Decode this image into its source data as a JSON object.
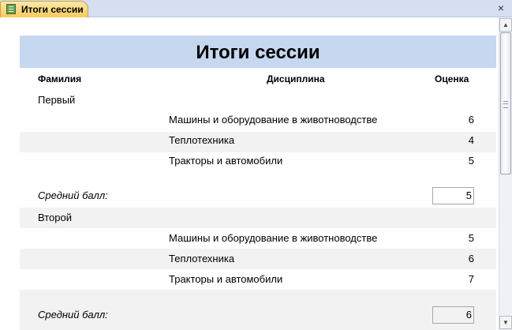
{
  "tab": {
    "title": "Итоги сессии",
    "icon": "report-icon",
    "close": "×"
  },
  "report": {
    "title": "Итоги сессии",
    "columns": {
      "surname": "Фамилия",
      "discipline": "Дисциплина",
      "grade": "Оценка"
    },
    "avg_label": "Средний балл:",
    "groups": [
      {
        "name": "Первый",
        "rows": [
          {
            "discipline": "Машины и оборудование в животноводстве",
            "grade": "6"
          },
          {
            "discipline": "Теплотехника",
            "grade": "4"
          },
          {
            "discipline": "Тракторы и автомобили",
            "grade": "5"
          }
        ],
        "average": "5"
      },
      {
        "name": "Второй",
        "rows": [
          {
            "discipline": "Машины и оборудование в животноводстве",
            "grade": "5"
          },
          {
            "discipline": "Теплотехника",
            "grade": "6"
          },
          {
            "discipline": "Тракторы и автомобили",
            "grade": "7"
          }
        ],
        "average": "6"
      }
    ]
  },
  "scrollbar": {
    "up": "▲",
    "down": "▼"
  }
}
